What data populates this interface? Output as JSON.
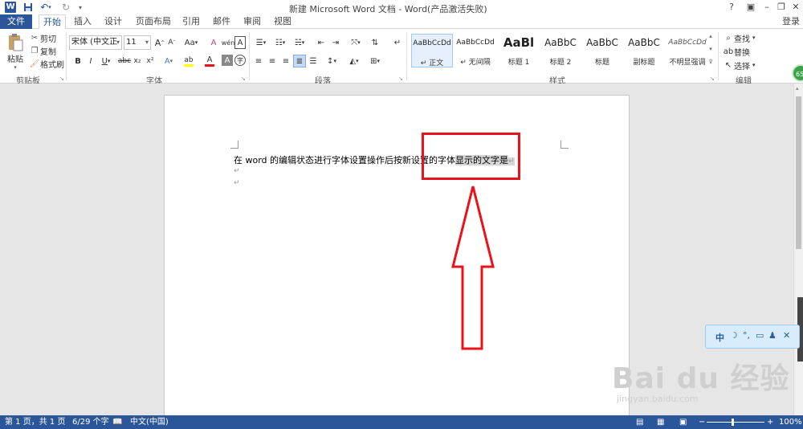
{
  "titlebar": {
    "app_logo": "W",
    "title": "新建 Microsoft Word 文档 - Word(产品激活失败)",
    "quick_access": [
      "save-icon",
      "undo-icon",
      "redo-icon",
      "customize-icon"
    ],
    "help": "?",
    "login": "登录"
  },
  "tabs": {
    "file": "文件",
    "items": [
      "开始",
      "插入",
      "设计",
      "页面布局",
      "引用",
      "邮件",
      "审阅",
      "视图"
    ],
    "active": "开始"
  },
  "clipboard": {
    "paste": "粘贴",
    "cut": "剪切",
    "copy": "复制",
    "format_painter": "格式刷",
    "label": "剪贴板"
  },
  "font": {
    "name": "宋体 (中文正",
    "size": "11",
    "grow": "A",
    "shrink": "A",
    "case": "Aa",
    "clear": "A",
    "phonetic": "wén",
    "charborder": "A",
    "bold": "B",
    "italic": "I",
    "underline": "U",
    "strike": "abc",
    "subscript": "x₂",
    "superscript": "x²",
    "effects": "A",
    "highlight": "ab",
    "color": "A",
    "shading": "A",
    "enclose": "字",
    "label": "字体"
  },
  "paragraph": {
    "label": "段落"
  },
  "styles": {
    "label": "样式",
    "items": [
      {
        "sample": "AaBbCcDd",
        "name": "↵ 正文"
      },
      {
        "sample": "AaBbCcDd",
        "name": "↵ 无间隔"
      },
      {
        "sample": "AaBl",
        "name": "标题 1"
      },
      {
        "sample": "AaBbC",
        "name": "标题 2"
      },
      {
        "sample": "AaBbC",
        "name": "标题"
      },
      {
        "sample": "AaBbC",
        "name": "副标题"
      },
      {
        "sample": "AaBbCcDd",
        "name": "不明显强调"
      }
    ]
  },
  "editing": {
    "find": "查找",
    "replace": "替换",
    "select": "选择",
    "label": "编辑"
  },
  "document": {
    "line1_plain": "在 word 的编辑状态进行字体设置操作后按新设置的字体",
    "line1_selected": "显示的文字是",
    "pilcrow": "↵"
  },
  "ime": {
    "mode": "中"
  },
  "badge": "65",
  "watermark": {
    "main": "Bai du 经验",
    "url": "jingyan.baidu.com"
  },
  "status": {
    "page": "第 1 页，共 1 页",
    "words": "6/29 个字",
    "language": "中文(中国)",
    "zoom": "100%",
    "zoom_minus": "−",
    "zoom_plus": "+"
  },
  "colors": {
    "brand": "#2b579a",
    "annotation_red": "#e8131b",
    "selection": "#d6d6d6"
  }
}
